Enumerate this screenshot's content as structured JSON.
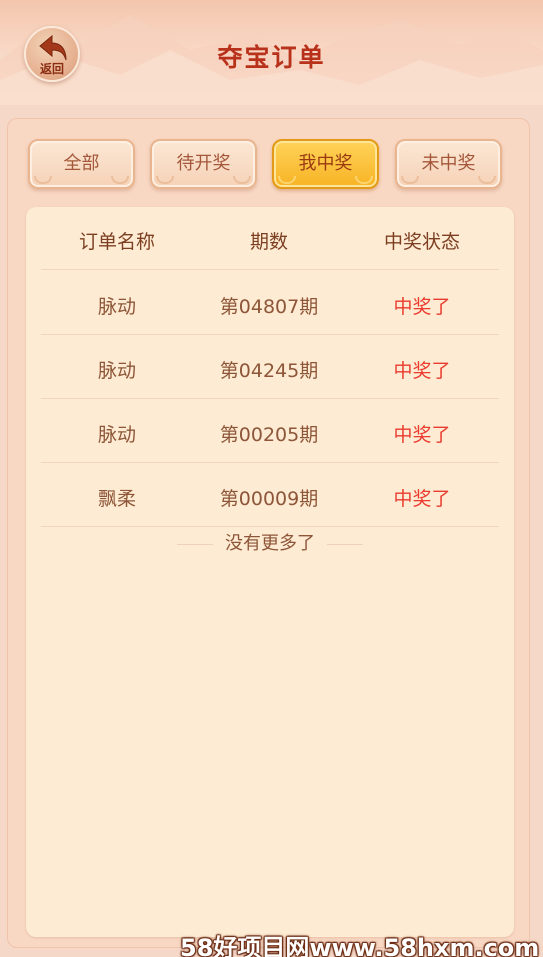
{
  "header": {
    "back_label": "返回",
    "title": "夺宝订单"
  },
  "tabs": [
    {
      "label": "全部",
      "active": false
    },
    {
      "label": "待开奖",
      "active": false
    },
    {
      "label": "我中奖",
      "active": true
    },
    {
      "label": "未中奖",
      "active": false
    }
  ],
  "table": {
    "columns": [
      "订单名称",
      "期数",
      "中奖状态"
    ],
    "rows": [
      {
        "name": "脉动",
        "period": "第04807期",
        "status": "中奖了"
      },
      {
        "name": "脉动",
        "period": "第04245期",
        "status": "中奖了"
      },
      {
        "name": "脉动",
        "period": "第00205期",
        "status": "中奖了"
      },
      {
        "name": "飘柔",
        "period": "第00009期",
        "status": "中奖了"
      }
    ],
    "no_more": "没有更多了"
  },
  "watermark": "58好项目网www.58hxm.com",
  "colors": {
    "title": "#b8311a",
    "status_win": "#ea3b2e",
    "active_tab": "#f7b324",
    "background": "#f6d8c8"
  }
}
